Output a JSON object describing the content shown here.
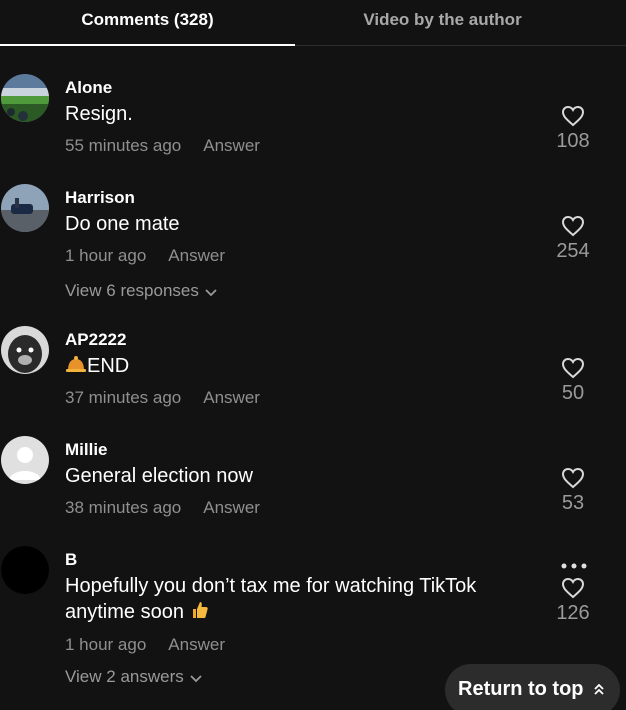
{
  "tabs": {
    "comments": "Comments (328)",
    "video_by_author": "Video by the author"
  },
  "comments": [
    {
      "username": "Alone",
      "text": "Resign.",
      "time": "55 minutes ago",
      "reply": "Answer",
      "likes": "108",
      "avatar": "stadium-photo"
    },
    {
      "username": "Harrison",
      "text": "Do one mate",
      "time": "1 hour ago",
      "reply": "Answer",
      "likes": "254",
      "view_more": "View 6 responses",
      "avatar": "car-photo"
    },
    {
      "username": "AP2222",
      "text": "END",
      "emoji": "bell-icon",
      "time": "37 minutes ago",
      "reply": "Answer",
      "likes": "50",
      "avatar": "dog-photo"
    },
    {
      "username": "Millie",
      "text": "General election now",
      "time": "38 minutes ago",
      "reply": "Answer",
      "likes": "53",
      "avatar": "default-user"
    },
    {
      "username": "B",
      "text_line1": "Hopefully you don’t tax me for watching TikTok",
      "text_line2": "anytime soon",
      "emoji": "thumbs-up-icon",
      "time": "1 hour ago",
      "reply": "Answer",
      "likes": "126",
      "view_more": "View 2 answers",
      "avatar": "black-circle"
    }
  ],
  "return_to_top": "Return to top",
  "colors": {
    "background": "#121212",
    "muted_text": "#8f8f8f",
    "button_bg": "#2c2c2c"
  }
}
